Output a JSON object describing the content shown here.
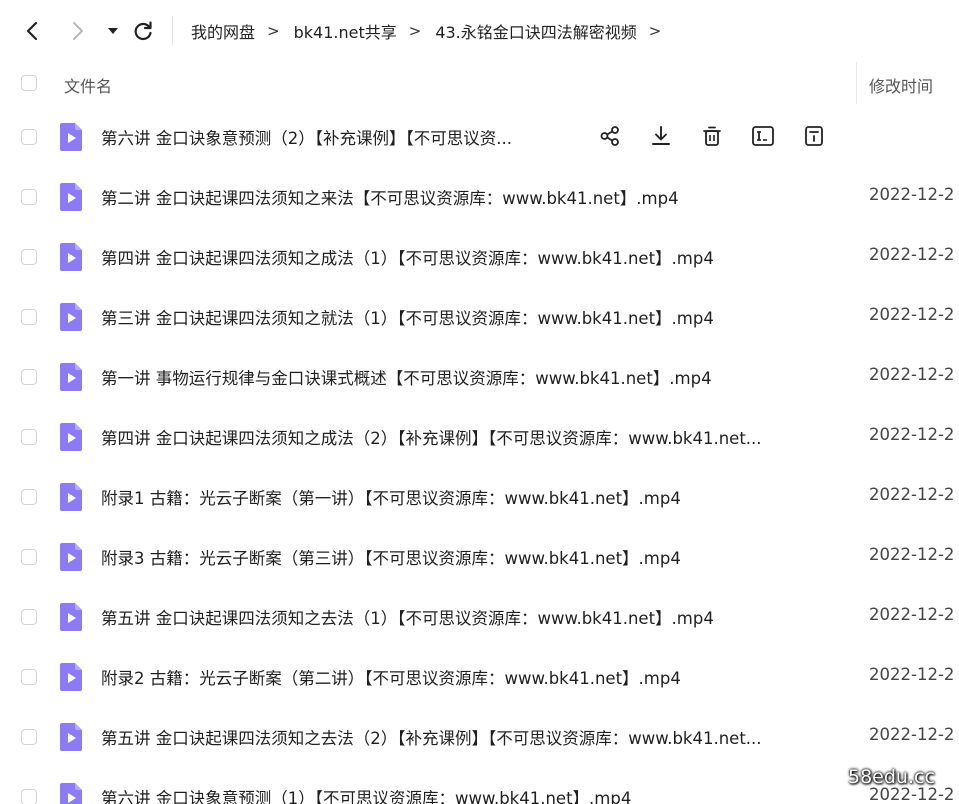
{
  "nav": {
    "back_icon": "chevron-left-icon",
    "forward_icon": "chevron-right-icon",
    "dropdown_icon": "caret-down-icon",
    "refresh_icon": "refresh-icon"
  },
  "breadcrumb": {
    "items": [
      "我的网盘",
      "bk41.net共享",
      "43.永铭金口诀四法解密视频"
    ],
    "separator": ">"
  },
  "header": {
    "name_label": "文件名",
    "time_label": "修改时间"
  },
  "files": [
    {
      "name": "第六讲  金口诀象意预测（2）【补充课例】【不可思议资...",
      "time": ""
    },
    {
      "name": "第二讲  金口诀起课四法须知之来法【不可思议资源库：www.bk41.net】.mp4",
      "time": "2022-12-2"
    },
    {
      "name": "第四讲  金口诀起课四法须知之成法（1）【不可思议资源库：www.bk41.net】.mp4",
      "time": "2022-12-2"
    },
    {
      "name": "第三讲  金口诀起课四法须知之就法（1）【不可思议资源库：www.bk41.net】.mp4",
      "time": "2022-12-2"
    },
    {
      "name": "第一讲  事物运行规律与金口诀课式概述【不可思议资源库：www.bk41.net】.mp4",
      "time": "2022-12-2"
    },
    {
      "name": "第四讲  金口诀起课四法须知之成法（2）【补充课例】【不可思议资源库：www.bk41.net...",
      "time": "2022-12-2"
    },
    {
      "name": "附录1 古籍：光云子断案（第一讲）【不可思议资源库：www.bk41.net】.mp4",
      "time": "2022-12-2"
    },
    {
      "name": "附录3 古籍：光云子断案（第三讲）【不可思议资源库：www.bk41.net】.mp4",
      "time": "2022-12-2"
    },
    {
      "name": "第五讲  金口诀起课四法须知之去法（1）【不可思议资源库：www.bk41.net】.mp4",
      "time": "2022-12-2"
    },
    {
      "name": "附录2 古籍：光云子断案（第二讲）【不可思议资源库：www.bk41.net】.mp4",
      "time": "2022-12-2"
    },
    {
      "name": "第五讲  金口诀起课四法须知之去法（2）【补充课例】【不可思议资源库：www.bk41.net...",
      "time": "2022-12-2"
    },
    {
      "name": "第六讲  金口诀象意预测（1）【不可思议资源库：www.bk41.net】.mp4",
      "time": "2022-12-2"
    }
  ],
  "row_actions": [
    "share-icon",
    "download-icon",
    "delete-icon",
    "rename-icon",
    "details-icon"
  ],
  "file_icon": "video-file-icon",
  "colors": {
    "file_icon": "#8b7cf6",
    "checkbox_border": "#cfd2d8"
  },
  "watermark": "58edu.cc"
}
